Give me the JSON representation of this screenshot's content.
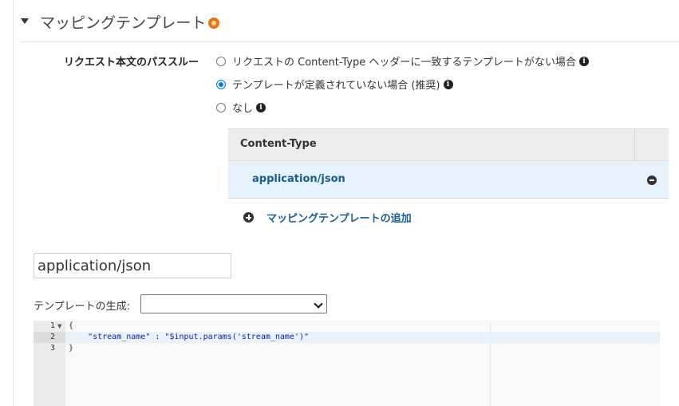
{
  "section": {
    "title": "マッピングテンプレート"
  },
  "passthrough": {
    "label": "リクエスト本文のパススルー",
    "options": [
      {
        "label": "リクエストの Content-Type ヘッダーに一致するテンプレートがない場合",
        "checked": false
      },
      {
        "label": "テンプレートが定義されていない場合 (推奨)",
        "checked": true
      },
      {
        "label": "なし",
        "checked": false
      }
    ]
  },
  "content_types": {
    "header": "Content-Type",
    "rows": [
      "application/json"
    ],
    "add_label": "マッピングテンプレートの追加"
  },
  "content_type_input": {
    "value": "application/json"
  },
  "template_generate": {
    "label": "テンプレートの生成:",
    "selected": ""
  },
  "editor": {
    "line_numbers": [
      "1",
      "2",
      "3"
    ],
    "lines": [
      "{",
      "    \"stream_name\" : \"$input.params('stream_name')\"",
      "}"
    ]
  },
  "colors": {
    "accent": "#ec7211",
    "link": "#1a5c8e",
    "selected_row": "#e6f2fb",
    "radio": "#0075ff"
  },
  "icons": {
    "warning": "warning-dot-icon",
    "info": "info-icon",
    "remove": "minus-circle-icon",
    "add": "plus-circle-icon"
  }
}
